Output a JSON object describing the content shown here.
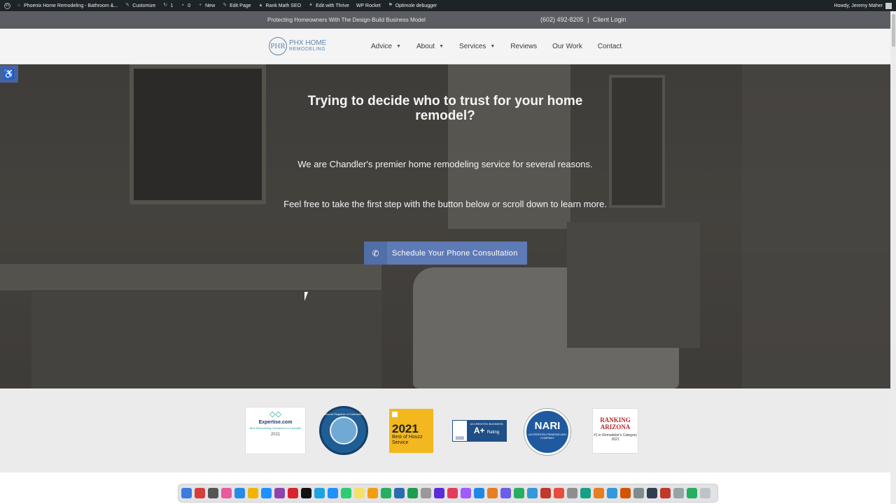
{
  "admin_bar": {
    "site_name": "Phoenix Home Remodeling - Bathroom &...",
    "customize": "Customize",
    "updates_count": "1",
    "comments_count": "0",
    "new": "New",
    "edit_page": "Edit Page",
    "rank_math": "Rank Math SEO",
    "edit_thrive": "Edit with Thrive",
    "wp_rocket": "WP Rocket",
    "optimole": "Optimole debugger",
    "howdy": "Howdy, Jeremy Maher"
  },
  "top_bar": {
    "tagline": "Protecting Homeowners With The Design-Build Business Model",
    "phone": "(602) 492-8205",
    "separator": "|",
    "client_login": "Client Login"
  },
  "logo": {
    "mark": "PHR",
    "line1": "PHX HOME",
    "line2": "REMODELING"
  },
  "nav": [
    {
      "label": "Advice",
      "has_dropdown": true
    },
    {
      "label": "About",
      "has_dropdown": true
    },
    {
      "label": "Services",
      "has_dropdown": true
    },
    {
      "label": "Reviews",
      "has_dropdown": false
    },
    {
      "label": "Our Work",
      "has_dropdown": false
    },
    {
      "label": "Contact",
      "has_dropdown": false
    }
  ],
  "hero": {
    "title": "Trying to decide who to trust for your home remodel?",
    "paragraph1": "We are Chandler's premier home remodeling service for several reasons.",
    "paragraph2": "Feel free to take the first step with the button below or scroll down to learn more.",
    "cta_label": "Schedule Your Phone Consultation"
  },
  "badges": {
    "expertise": {
      "name": "Expertise.com",
      "sub": "Best Remodeling Contractors in Chandler",
      "year": "2021"
    },
    "roc": {
      "text": "Arizona Registrar of Contractors"
    },
    "houzz": {
      "year": "2021",
      "text": "Best of Houzz Service"
    },
    "bbb": {
      "acc": "ACCREDITED BUSINESS",
      "rating": "A+",
      "rating_suffix": "Rating",
      "seal": "BBB"
    },
    "nari": {
      "name": "NARI",
      "sub": "ACCREDITED REMODELING COMPANY",
      "ring": "Remodeling Done Right"
    },
    "ranking_az": {
      "title": "RANKING ARIZONA",
      "sub": "#1 in Remodeler's Category 2021"
    }
  },
  "colors": {
    "accent": "#5e7bb5",
    "topbar": "#5b5d62",
    "adminbar": "#1d2327"
  }
}
